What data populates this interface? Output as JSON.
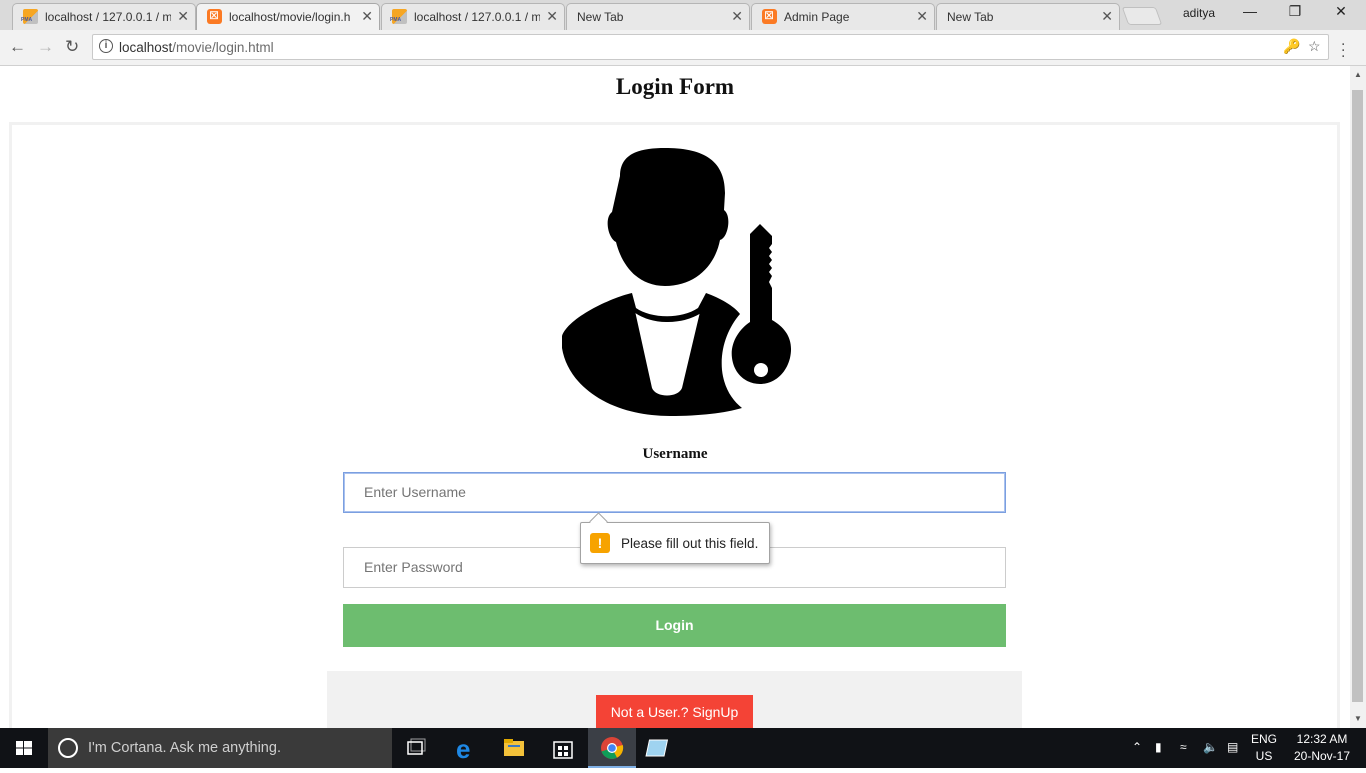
{
  "browser": {
    "tabs": [
      {
        "title": "localhost / 127.0.0.1 / m",
        "favicon": "phpmyadmin-icon"
      },
      {
        "title": "localhost/movie/login.h",
        "favicon": "xampp-icon",
        "active": true
      },
      {
        "title": "localhost / 127.0.0.1 / m",
        "favicon": "phpmyadmin-icon"
      },
      {
        "title": "New Tab",
        "favicon": ""
      },
      {
        "title": "Admin Page",
        "favicon": "xampp-icon"
      },
      {
        "title": "New Tab",
        "favicon": ""
      }
    ],
    "tab_close_glyph": "✕",
    "profile_name": "aditya",
    "url_host": "localhost",
    "url_path": "/movie/login.html",
    "window_controls": {
      "minimize": "—",
      "restore": "❐",
      "close": "✕"
    }
  },
  "page": {
    "title": "Login Form",
    "username_label": "Username",
    "username_placeholder": "Enter Username",
    "password_placeholder": "Enter Password",
    "login_button": "Login",
    "signup_button": "Not a User.? SignUp",
    "validation_message": "Please fill out this field.",
    "validation_icon": "!"
  },
  "taskbar": {
    "cortana_text": "I'm Cortana. Ask me anything.",
    "language_line1": "ENG",
    "language_line2": "US",
    "time": "12:32 AM",
    "date": "20-Nov-17"
  },
  "colors": {
    "login_button": "#6dbd6f",
    "signup_button": "#f44336",
    "warning": "#f7a300",
    "focus_border": "#7b9fe0"
  }
}
